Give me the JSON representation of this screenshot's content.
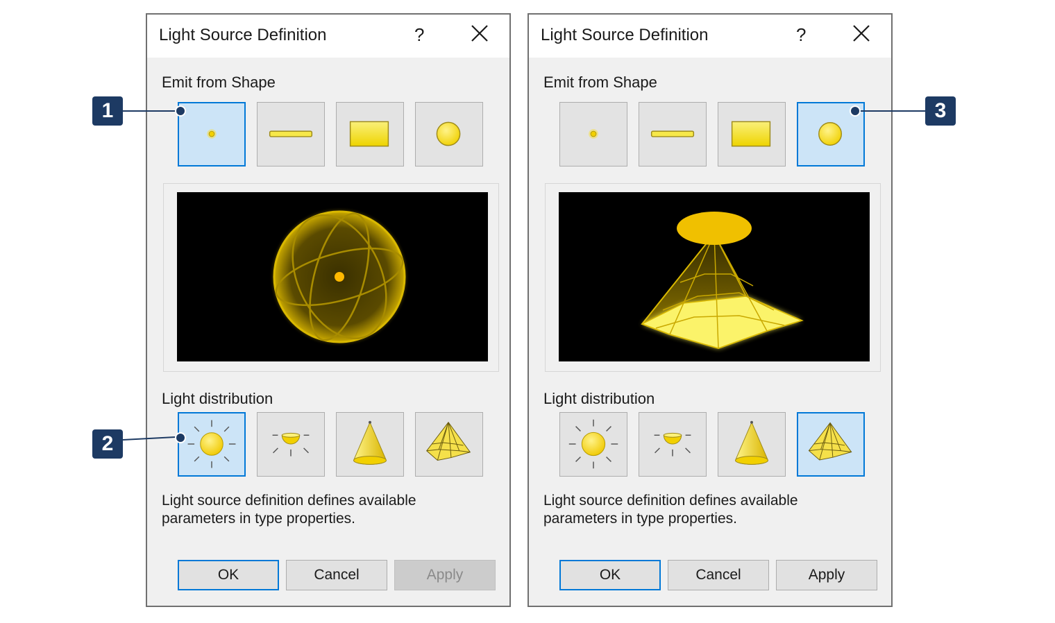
{
  "dialogs": [
    {
      "title": "Light Source Definition",
      "help_label": "?",
      "emit_label": "Emit from Shape",
      "distribution_label": "Light distribution",
      "description": "Light source definition defines available parameters in type properties.",
      "selected_shape": "point",
      "selected_distribution": "spherical",
      "ok_label": "OK",
      "cancel_label": "Cancel",
      "apply_label": "Apply",
      "apply_enabled": false,
      "preview": "spherical-point"
    },
    {
      "title": "Light Source Definition",
      "help_label": "?",
      "emit_label": "Emit from Shape",
      "distribution_label": "Light distribution",
      "description": "Light source definition defines available parameters in type properties.",
      "selected_shape": "circle",
      "selected_distribution": "photometric-web",
      "ok_label": "OK",
      "cancel_label": "Cancel",
      "apply_label": "Apply",
      "apply_enabled": true,
      "preview": "photometric-web-circle"
    }
  ],
  "shape_options": [
    "point-icon",
    "line-icon",
    "rectangle-icon",
    "circle-icon"
  ],
  "distribution_options": [
    "spherical-icon",
    "hemispherical-icon",
    "spot-icon",
    "photometric-web-icon"
  ],
  "callouts": [
    "1",
    "2",
    "3"
  ],
  "colors": {
    "accent": "#0078d7",
    "selected_bg": "#cce4f7",
    "callout": "#1d3a63",
    "light": "#f2d600"
  }
}
